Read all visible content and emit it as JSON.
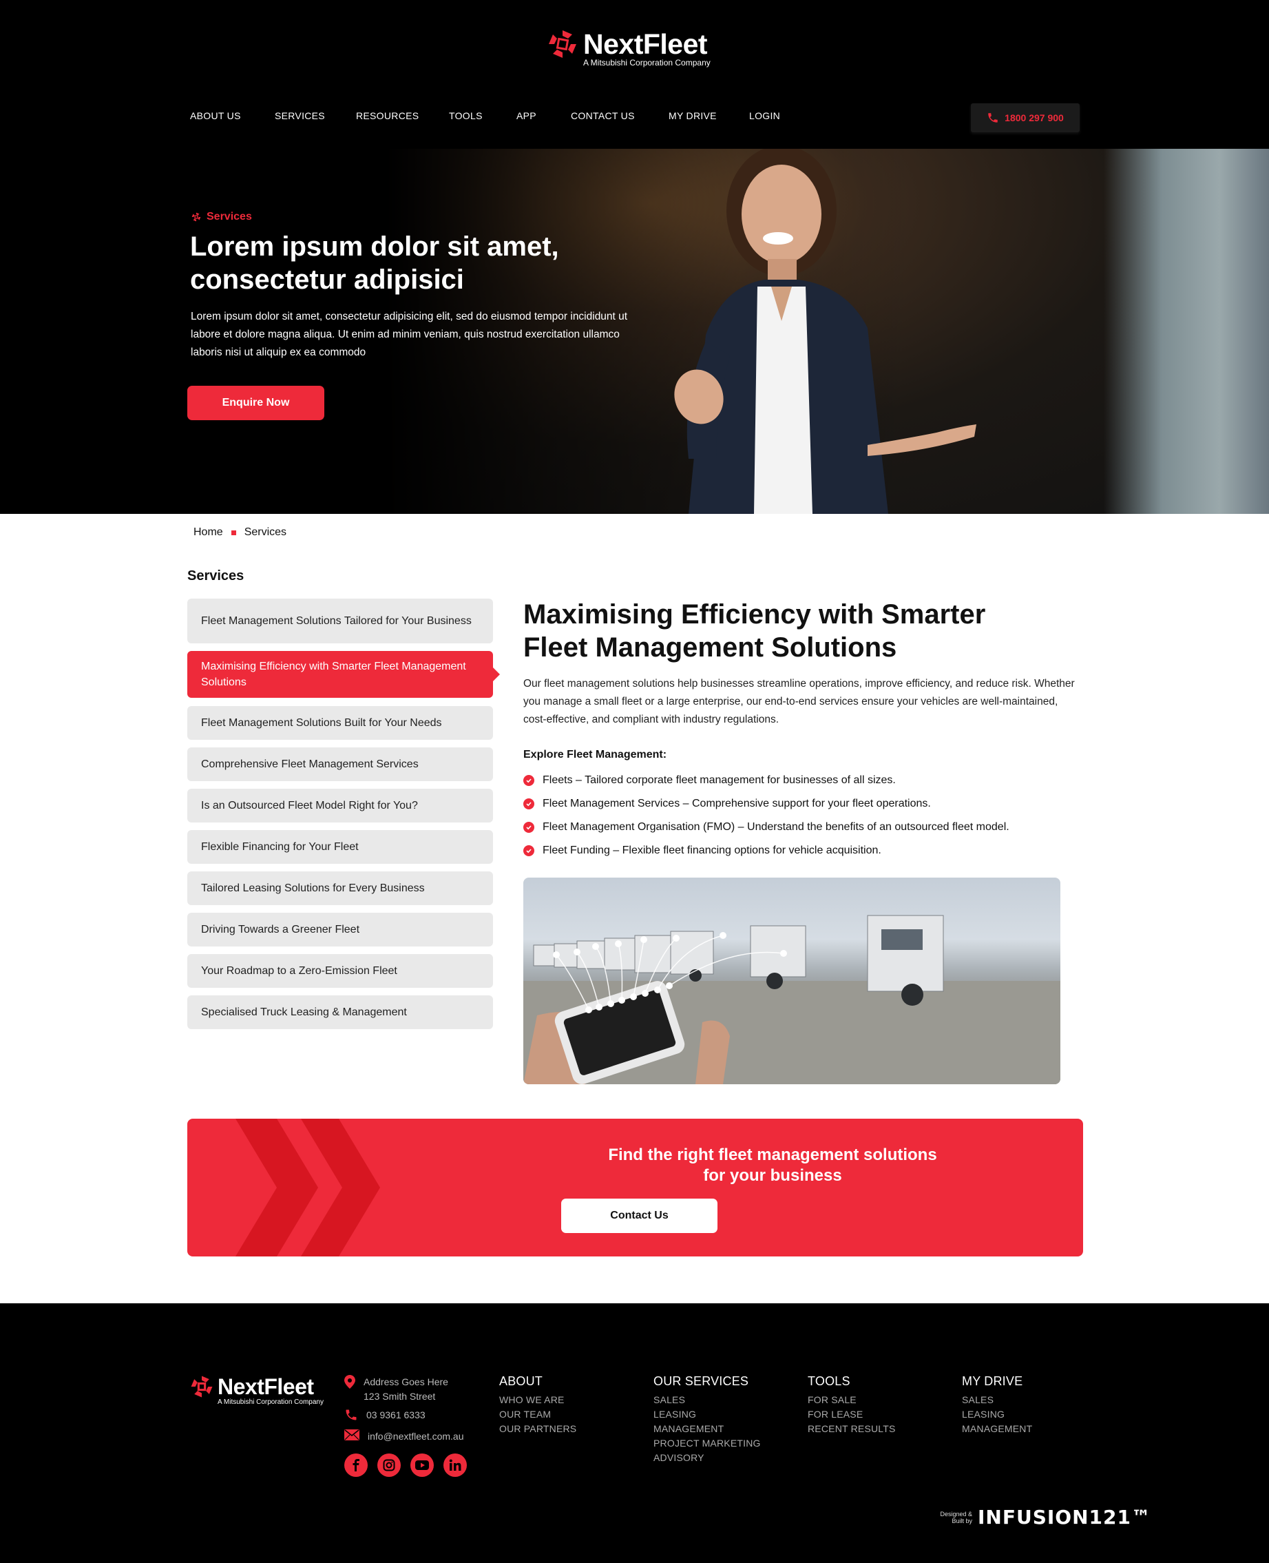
{
  "brand": {
    "name": "NextFleet",
    "tagline": "A Mitsubishi Corporation Company"
  },
  "nav": [
    {
      "label": "ABOUT US"
    },
    {
      "label": "SERVICES"
    },
    {
      "label": "RESOURCES"
    },
    {
      "label": "TOOLS"
    },
    {
      "label": "APP"
    },
    {
      "label": "CONTACT US"
    },
    {
      "label": "MY DRIVE"
    },
    {
      "label": "LOGIN"
    }
  ],
  "phone": "1800 297 900",
  "hero": {
    "eyebrow": "Services",
    "title": "Lorem ipsum dolor sit amet, consectetur adipisici",
    "text": "Lorem ipsum dolor sit amet, consectetur adipisicing elit, sed do eiusmod tempor incididunt ut labore et dolore magna aliqua. Ut enim ad minim veniam, quis nostrud exercitation ullamco laboris nisi ut aliquip ex ea commodo",
    "button": "Enquire Now"
  },
  "breadcrumb": {
    "home": "Home",
    "current": "Services"
  },
  "sidebar": {
    "title": "Services",
    "items": [
      {
        "label": "Fleet Management Solutions Tailored for Your Business"
      },
      {
        "label": "Maximising Efficiency with Smarter Fleet Management Solutions",
        "active": true
      },
      {
        "label": "Fleet Management Solutions Built for Your Needs"
      },
      {
        "label": "Comprehensive Fleet Management Services"
      },
      {
        "label": "Is an Outsourced Fleet Model Right for You?"
      },
      {
        "label": "Flexible Financing for Your Fleet"
      },
      {
        "label": "Tailored Leasing Solutions for Every Business"
      },
      {
        "label": "Driving Towards a Greener Fleet"
      },
      {
        "label": "Your Roadmap to a Zero-Emission Fleet"
      },
      {
        "label": "Specialised Truck Leasing & Management"
      }
    ]
  },
  "main": {
    "title": "Maximising Efficiency with Smarter Fleet Management Solutions",
    "intro": "Our fleet management solutions help businesses streamline operations, improve efficiency, and reduce risk. Whether you manage a small fleet or a large enterprise, our end-to-end services ensure your vehicles are well-maintained, cost-effective, and compliant with industry regulations.",
    "explore_title": "Explore Fleet Management:",
    "bullets": [
      "Fleets – Tailored corporate fleet management for businesses of all sizes.",
      "Fleet Management Services – Comprehensive support for your fleet operations.",
      "Fleet Management Organisation (FMO) – Understand the benefits of an outsourced fleet model.",
      "Fleet Funding – Flexible fleet financing options for vehicle acquisition."
    ]
  },
  "cta": {
    "title": "Find the right fleet management solutions for your business",
    "button": "Contact Us"
  },
  "footer": {
    "address_line1": "Address Goes Here",
    "address_line2": "123 Smith Street",
    "phone": "03 9361 6333",
    "email": "info@nextfleet.com.au",
    "social": [
      "facebook-icon",
      "instagram-icon",
      "youtube-icon",
      "linkedin-icon"
    ],
    "columns": [
      {
        "heading": "ABOUT",
        "links": [
          "WHO WE ARE",
          "OUR TEAM",
          "OUR PARTNERS"
        ]
      },
      {
        "heading": "OUR SERVICES",
        "links": [
          "SALES",
          "LEASING",
          "MANAGEMENT",
          "PROJECT MARKETING",
          "ADVISORY"
        ]
      },
      {
        "heading": "TOOLS",
        "links": [
          "FOR SALE",
          "FOR LEASE",
          "RECENT RESULTS"
        ]
      },
      {
        "heading": "MY DRIVE",
        "links": [
          "SALES",
          "LEASING",
          "MANAGEMENT"
        ]
      }
    ],
    "credit_small": "Designed & Built by",
    "credit_brand": "INFUSION121™"
  },
  "colors": {
    "accent": "#ee2a3a",
    "dark": "#000000",
    "panel": "#e9e9e9"
  }
}
